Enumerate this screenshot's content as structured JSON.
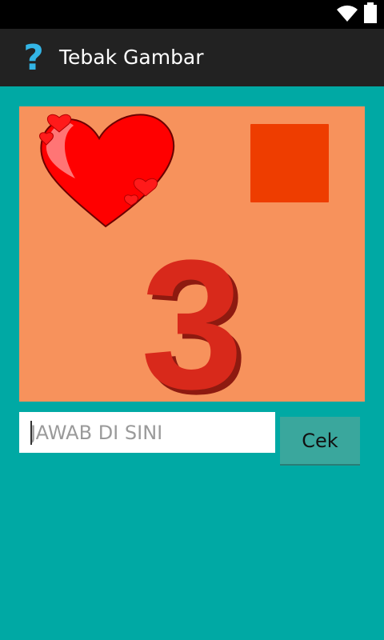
{
  "status_bar": {
    "icons": [
      "wifi-icon",
      "battery-icon"
    ]
  },
  "action_bar": {
    "icon": "question-mark-icon",
    "icon_glyph": "?",
    "title": "Tebak Gambar"
  },
  "puzzle": {
    "digit": "3",
    "shapes": [
      "heart",
      "square",
      "number-3"
    ]
  },
  "answer": {
    "placeholder": "JAWAB DI SINI",
    "value": ""
  },
  "check_button": {
    "label": "Cek"
  },
  "colors": {
    "background": "#00a9a4",
    "action_bar": "#222222",
    "puzzle_background": "#f7925c",
    "heart": "#ff0000",
    "square": "#ee3d00",
    "digit": "#d8291b",
    "button": "#3aa79d",
    "app_icon": "#33b5e5"
  }
}
